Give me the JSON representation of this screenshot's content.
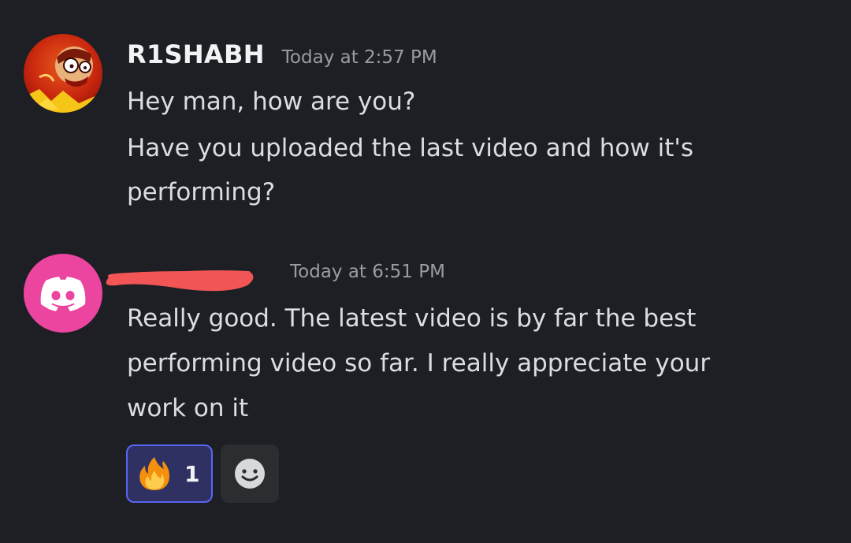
{
  "messages": [
    {
      "username": "R1SHABH",
      "timestamp": "Today at 2:57 PM",
      "lines": [
        "Hey man, how are you?",
        "Have you uploaded the last video and how it's",
        "performing?"
      ],
      "avatar_icon": "cartoon-avatar-icon"
    },
    {
      "username": "",
      "username_redacted": true,
      "timestamp": "Today at 6:51 PM",
      "lines": [
        "Really good. The latest video is by far the best",
        "performing video so far. I really appreciate your",
        "work on it"
      ],
      "avatar_icon": "discord-logo-icon",
      "avatar_color": "#eb459f"
    }
  ],
  "reactions": [
    {
      "emoji": "🔥",
      "emoji_icon": "fire-emoji-icon",
      "count": "1",
      "active": true
    }
  ],
  "add_reaction_icon": "smiley-add-reaction-icon",
  "colors": {
    "background": "#1e1f24",
    "username": "#f2f3f5",
    "timestamp": "#9b9ca3",
    "message_text": "#dbdee1",
    "reaction_active_bg": "#2f3163",
    "reaction_active_border": "#5865f2",
    "redaction": "#f25555"
  }
}
